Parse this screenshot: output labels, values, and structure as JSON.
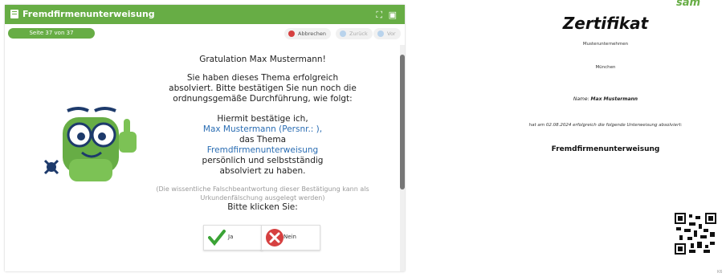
{
  "app": {
    "title": "Fremdfirmenunterweisung",
    "page_indicator": "Seite 37 von 37",
    "toolbar": {
      "cancel_label": "Abbrechen",
      "back_label": "Zurück",
      "forward_label": "Vor"
    },
    "window_controls": "⛶ ▣"
  },
  "message": {
    "greeting": "Gratulation Max Mustermann!",
    "line1": "Sie haben dieses Thema erfolgreich",
    "line2": "absolviert. Bitte bestätigen Sie nun noch die",
    "line3": "ordnungsgemäße Durchführung, wie folgt:",
    "confirm_intro": "Hiermit bestätige ich,",
    "person": "Max Mustermann (Persnr.: ),",
    "topic_intro": "das Thema",
    "topic": "Fremdfirmenunterweisung",
    "confirm_line1": "persönlich und selbstständig",
    "confirm_line2": "absolviert zu haben.",
    "disclaimer1": "(Die wissentliche Falschbeantwortung dieser Bestätigung kann als",
    "disclaimer2": "Urkundenfälschung ausgelegt werden)",
    "prompt": "Bitte klicken Sie:",
    "yes_label": "Ja",
    "no_label": "Nein"
  },
  "certificate": {
    "logo": "sam",
    "title": "Zertifikat",
    "company": "Musterunternehmen",
    "city": "München",
    "name_label": "Name:",
    "name": "Max Mustermann",
    "statement": "hat am 02.08.2024 erfolgreich die folgende Unterweisung absolviert:",
    "subject": "Fremdfirmenunterweisung",
    "corner_mark": "K6"
  },
  "colors": {
    "brand_green": "#67ad45",
    "link_blue": "#2a6db3",
    "cancel_red": "#d64040"
  }
}
